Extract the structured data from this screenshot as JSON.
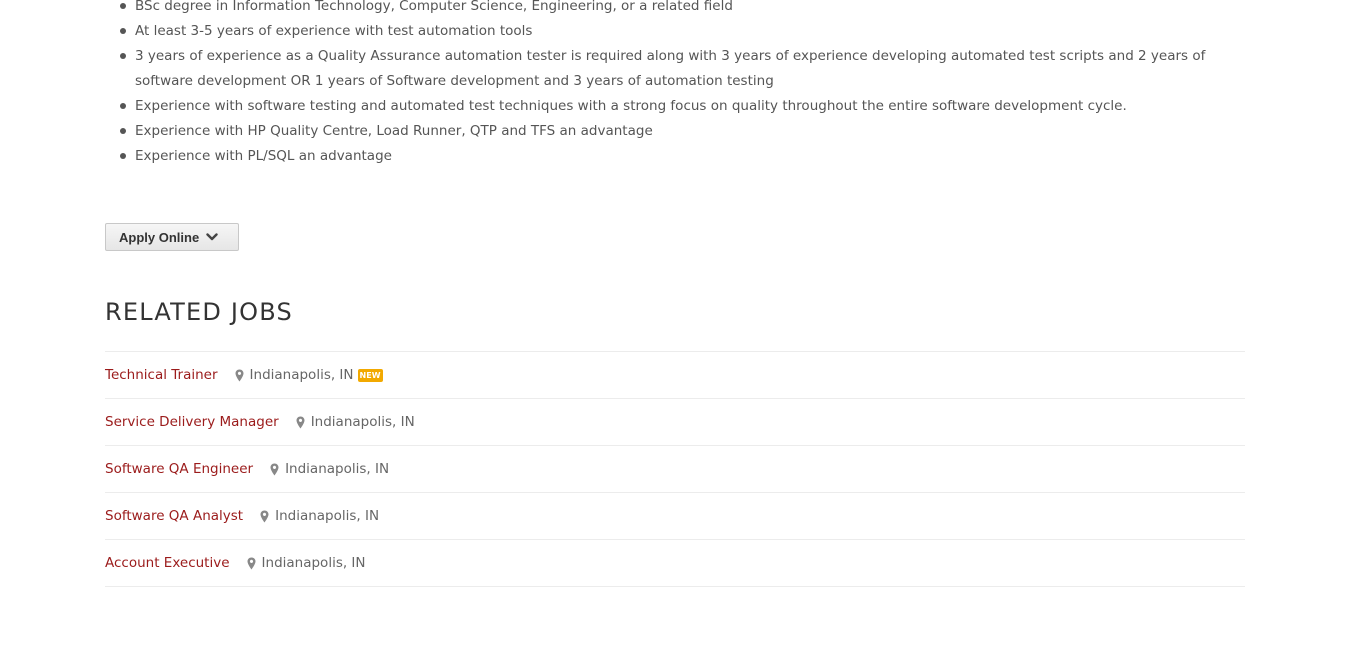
{
  "requirements": [
    "BSc degree in Information Technology, Computer Science, Engineering, or a related field",
    "At least 3-5 years of experience with test automation tools",
    "3 years of experience as a Quality Assurance automation tester is required along with 3 years of experience developing automated test scripts and 2 years of software development OR 1 years of Software development and 3 years of automation testing",
    "Experience with software testing and automated test techniques with a strong focus on quality throughout the entire software development cycle.",
    "Experience with HP Quality Centre, Load Runner, QTP and TFS an advantage",
    "Experience with PL/SQL an advantage"
  ],
  "apply": {
    "label": "Apply Online",
    "icon": "chevron-down-icon"
  },
  "related": {
    "title": "RELATED JOBS",
    "location_icon": "map-pin-icon",
    "jobs": [
      {
        "title": "Technical Trainer",
        "location": "Indianapolis, IN",
        "badge": "NEW"
      },
      {
        "title": "Service Delivery Manager",
        "location": "Indianapolis, IN",
        "badge": ""
      },
      {
        "title": "Software QA Engineer",
        "location": "Indianapolis, IN",
        "badge": ""
      },
      {
        "title": "Software QA Analyst",
        "location": "Indianapolis, IN",
        "badge": ""
      },
      {
        "title": "Account Executive",
        "location": "Indianapolis, IN",
        "badge": ""
      }
    ]
  },
  "colors": {
    "link": "#9b1b1b",
    "badge": "#f2a900",
    "text": "#555555"
  }
}
